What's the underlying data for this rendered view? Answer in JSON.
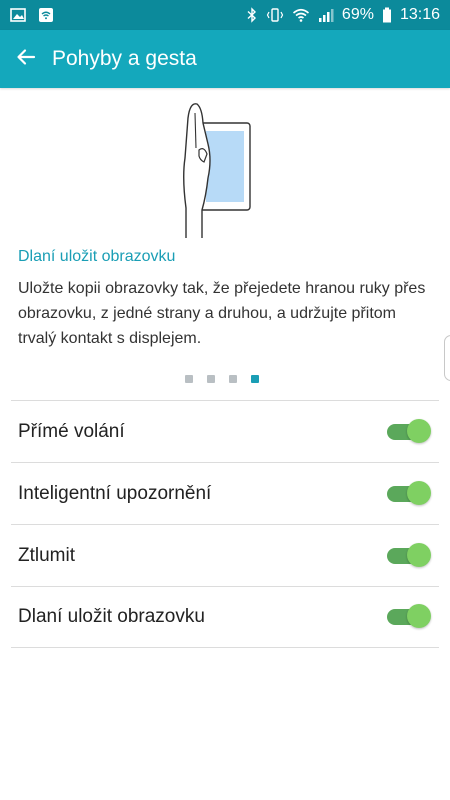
{
  "status_bar": {
    "battery": "69%",
    "time": "13:16",
    "icons": [
      "gallery-icon",
      "wifi-square-icon",
      "bluetooth-icon",
      "vibrate-icon",
      "wifi-icon",
      "signal-icon",
      "battery-icon"
    ]
  },
  "app_bar": {
    "title": "Pohyby a gesta",
    "back_icon": "arrow-left-icon"
  },
  "feature": {
    "title": "Dlaní uložit obrazovku",
    "description": "Uložte kopii obrazovky tak, že přejedete hranou ruky přes obrazovku, z jedné strany a druhou, a udržujte přitom trvalý kontakt s displejem.",
    "pager": {
      "total": 4,
      "active_index": 3
    }
  },
  "settings": [
    {
      "label": "Přímé volání",
      "enabled": true
    },
    {
      "label": "Inteligentní upozornění",
      "enabled": true
    },
    {
      "label": "Ztlumit",
      "enabled": true
    },
    {
      "label": "Dlaní uložit obrazovku",
      "enabled": true
    }
  ],
  "colors": {
    "status_bar": "#0c8a9b",
    "app_bar": "#14a8bc",
    "accent": "#1a9eb5",
    "toggle_on_track": "#5ba85b",
    "toggle_on_thumb": "#7fd062"
  }
}
